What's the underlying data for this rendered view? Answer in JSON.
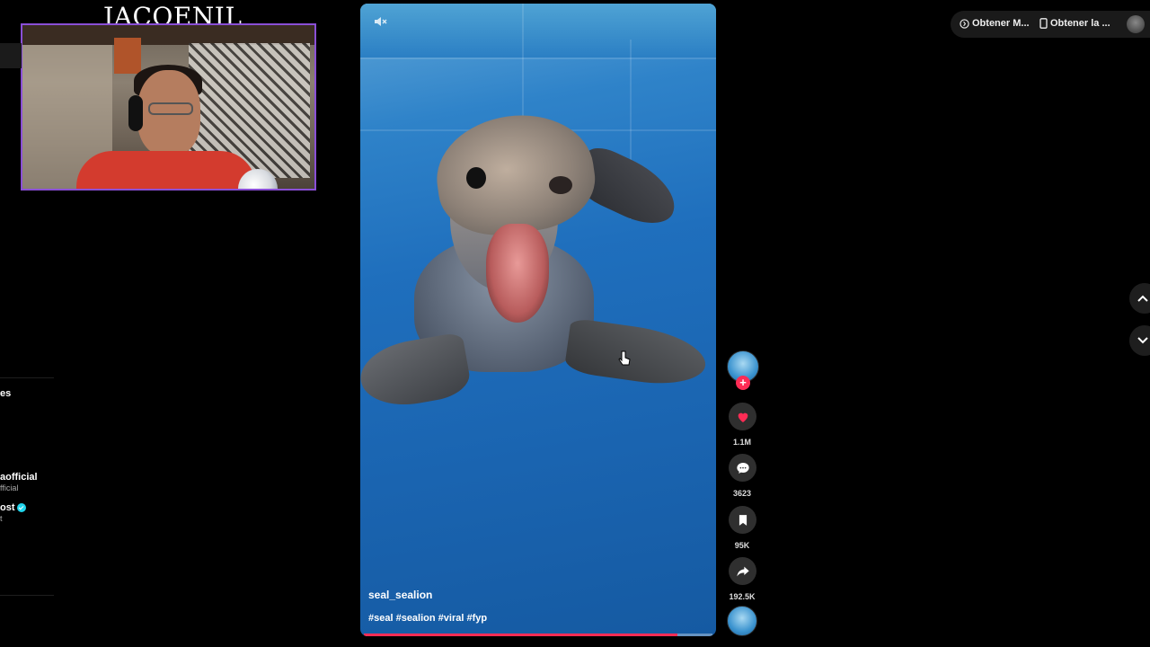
{
  "stream_overlay": {
    "streamer_name": "JACOENIL"
  },
  "sidebar": {
    "fragments": [
      {
        "text": "es"
      },
      {
        "text": "aofficial",
        "sub": "fficial"
      },
      {
        "text": "ost",
        "sub": "t",
        "verified": true
      }
    ]
  },
  "video": {
    "author": "seal_sealion",
    "tags": "#seal #sealion #viral #fyp",
    "progress": 0.9
  },
  "actions": {
    "likes": "1.1M",
    "comments": "3623",
    "saves": "95K",
    "shares": "192.5K"
  },
  "topbar": {
    "get_coins": "Obtener M...",
    "get_app": "Obtener la ..."
  },
  "colors": {
    "accent": "#fe2c55",
    "webcam_border": "#8a4fd6",
    "verified": "#20d5ec"
  },
  "icons": [
    "mute-icon",
    "heart-icon",
    "comment-icon",
    "bookmark-icon",
    "share-icon",
    "chevron-up-icon",
    "chevron-down-icon",
    "coin-icon",
    "phone-icon"
  ]
}
